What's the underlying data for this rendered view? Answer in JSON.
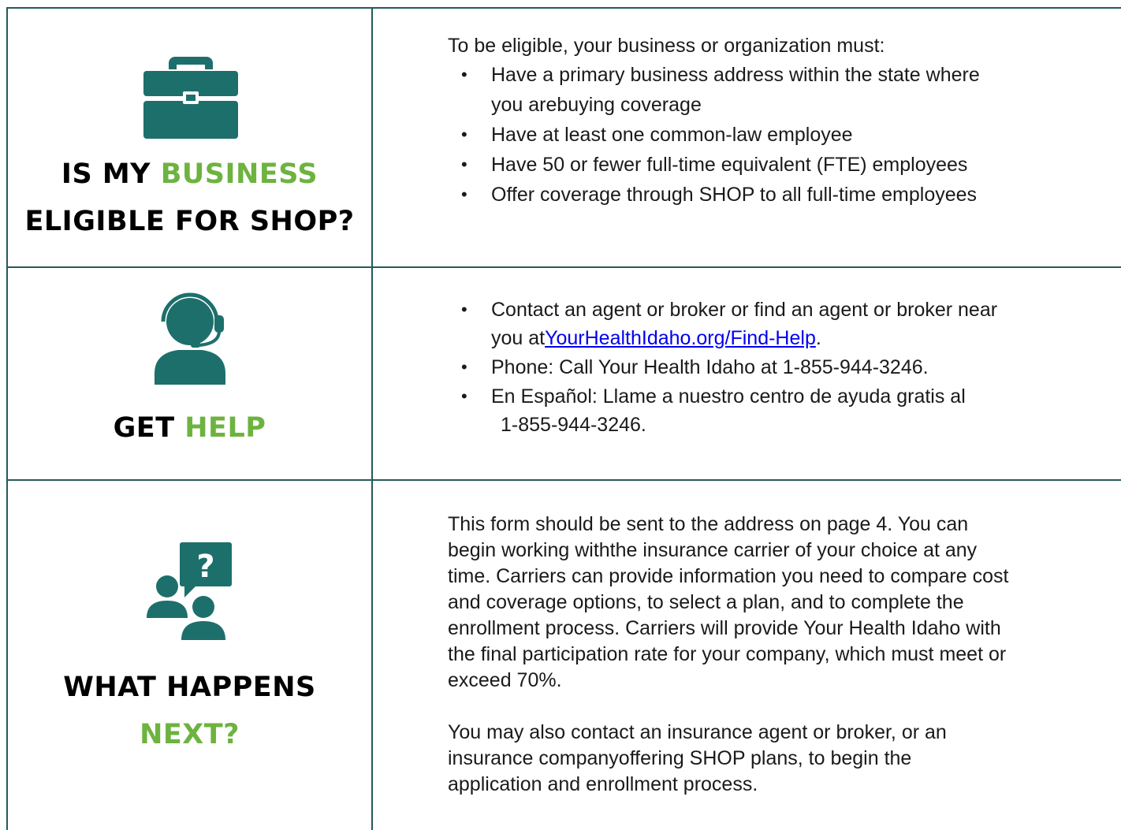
{
  "colors": {
    "teal": "#1d6f6c",
    "green": "#6db33f",
    "rule": "#245b58",
    "link": "#0000ee"
  },
  "sections": {
    "eligibility": {
      "icon": "briefcase-icon",
      "heading_line1_a": "IS MY ",
      "heading_line1_b": "BUSINESS",
      "heading_line2": "ELIGIBLE FOR SHOP?",
      "intro": "To be eligible, your business or organization must:",
      "bullets": [
        {
          "line1": "Have a primary business address within the state where",
          "line2": "you arebuying coverage"
        },
        {
          "line1": "Have at least one common-law employee"
        },
        {
          "line1": "Have 50 or fewer full-time equivalent (FTE) employees"
        },
        {
          "line1": "Offer coverage through SHOP to all full-time employees"
        }
      ]
    },
    "help": {
      "icon": "headset-agent-icon",
      "heading_a": "GET ",
      "heading_b": "HELP",
      "bullet1_line1": "Contact an agent or broker or find an agent or broker near",
      "bullet1_line2_prefix": "you at",
      "bullet1_link": "YourHealthIdaho.org/Find-Help",
      "bullet1_suffix": ".",
      "bullet2": "Phone: Call Your Health Idaho at 1-855-944-3246.",
      "bullet3_line1": "En Español: Llame a nuestro centro de ayuda gratis al",
      "bullet3_line2": "1-855-944-3246."
    },
    "next": {
      "icon": "question-people-icon",
      "heading_line1": "WHAT HAPPENS",
      "heading_line2": "NEXT?",
      "para1": [
        "This form should be sent to the address on page 4. You can",
        "begin working withthe insurance carrier of your choice at any",
        "time. Carriers can provide information you need to compare cost",
        "and coverage options, to select a plan, and to complete the",
        "enrollment process. Carriers will provide Your Health Idaho with",
        "the final participation rate for your company, which must meet or",
        "exceed 70%."
      ],
      "para2": [
        "You may also contact an insurance agent or broker, or an",
        "insurance companyoffering SHOP plans, to begin the",
        "application and enrollment process."
      ]
    }
  }
}
